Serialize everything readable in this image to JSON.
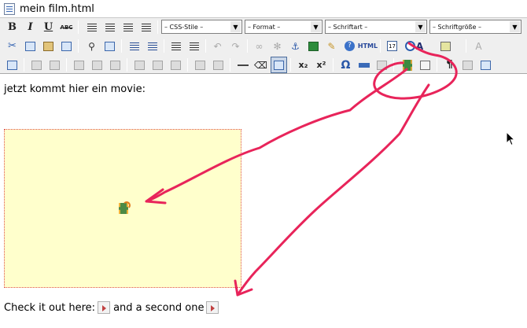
{
  "window": {
    "title": "mein film.html"
  },
  "toolbar": {
    "styles_select": "– CSS-Stile –",
    "format_select": "– Format –",
    "font_select": "– Schriftart –",
    "size_select": "– Schriftgröße –",
    "html_label": "HTML",
    "omega_label": "Ω",
    "paragraph_label": "¶",
    "subscript_label": "x₂",
    "superscript_label": "x²",
    "calendar_label": "17"
  },
  "editor": {
    "intro_text": "jetzt kommt hier ein movie:",
    "check_text": "Check it out here:",
    "second_text": "and a second one"
  },
  "colors": {
    "annotation": "#e8245a",
    "movie_background": "#ffffcc"
  }
}
